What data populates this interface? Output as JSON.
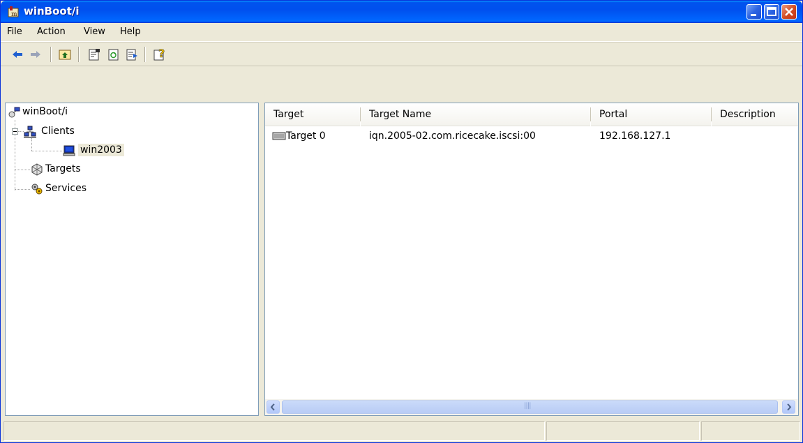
{
  "window": {
    "title": "winBoot/i",
    "title_color": "#0053ee"
  },
  "menu": {
    "items": [
      "File",
      "Action",
      "View",
      "Help"
    ]
  },
  "toolbar": {
    "buttons": [
      "back-arrow-icon",
      "forward-arrow-icon",
      "up-folder-icon",
      "properties-icon",
      "refresh-icon",
      "export-list-icon",
      "help-icon"
    ]
  },
  "tree": {
    "root": "winBoot/i",
    "clients": "Clients",
    "client_host": "win2003",
    "targets": "Targets",
    "services": "Services"
  },
  "list": {
    "columns": [
      "Target",
      "Target Name",
      "Portal",
      "Description"
    ],
    "rows": [
      {
        "target": "Target 0",
        "target_name": "iqn.2005-02.com.ricecake.iscsi:00",
        "portal": "192.168.127.1",
        "description": ""
      }
    ]
  },
  "scrollbar": {
    "grip": "||||"
  }
}
